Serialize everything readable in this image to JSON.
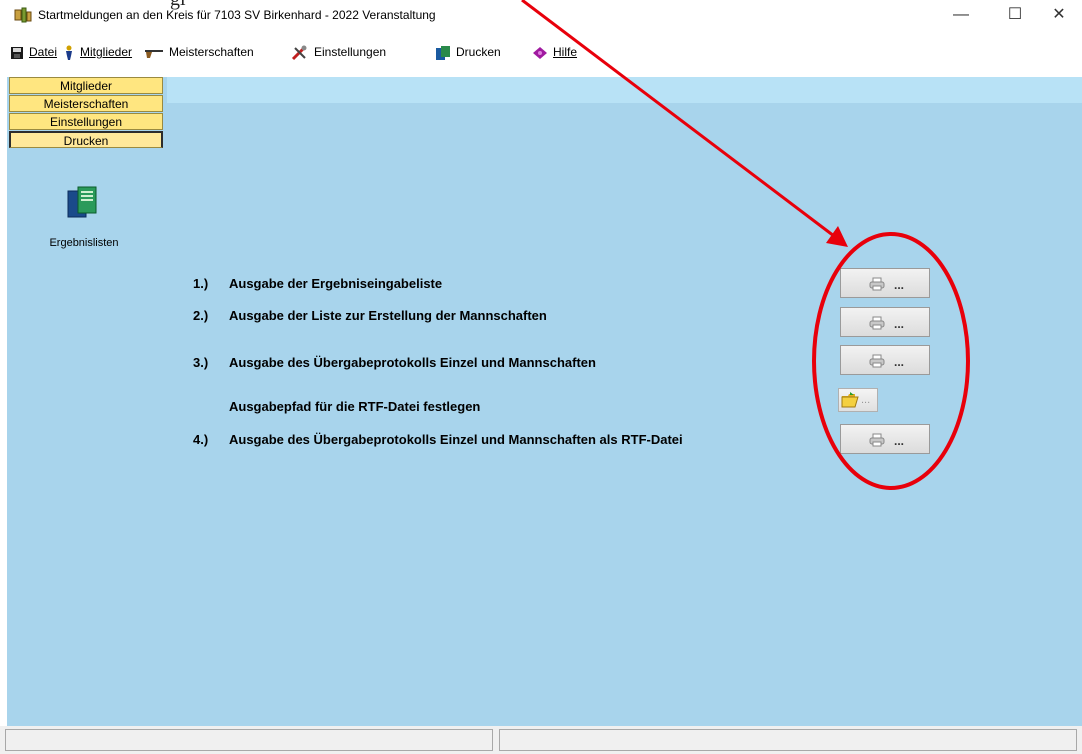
{
  "window": {
    "title": "Startmeldungen an den Kreis für 7103 SV Birkenhard - 2022  Veranstaltung",
    "controls": {
      "minimize": "—",
      "maximize": "☐",
      "close": "✕"
    }
  },
  "menu": [
    {
      "label": "Datei",
      "icon": "save-disk-icon"
    },
    {
      "label": "Mitglieder",
      "icon": "person-icon"
    },
    {
      "label": "Meisterschaften",
      "icon": "rifle-icon"
    },
    {
      "label": "Einstellungen",
      "icon": "tools-icon"
    },
    {
      "label": "Drucken",
      "icon": "printer-doc-icon"
    },
    {
      "label": "Hilfe",
      "icon": "help-book-icon"
    }
  ],
  "sidebar": {
    "nav": [
      {
        "label": "Mitglieder"
      },
      {
        "label": "Meisterschaften"
      },
      {
        "label": "Einstellungen"
      },
      {
        "label": "Drucken",
        "active": true
      }
    ],
    "tool": {
      "label": "Ergebnislisten",
      "icon": "result-lists-icon"
    }
  },
  "content": {
    "rows": [
      {
        "num": "1.)",
        "label": "Ausgabe der Ergebniseingabeliste",
        "button": "..."
      },
      {
        "num": "2.)",
        "label": "Ausgabe der Liste zur Erstellung der Mannschaften",
        "button": "..."
      },
      {
        "num": "3.)",
        "label": "Ausgabe des Übergabeprotokolls Einzel und Mannschaften",
        "button": "..."
      },
      {
        "num": "",
        "label": "Ausgabepfad für die RTF-Datei festlegen",
        "button": "..."
      },
      {
        "num": "4.)",
        "label": "Ausgabe des Übergabeprotokolls Einzel und Mannschaften als RTF-Datei",
        "button": "..."
      }
    ]
  },
  "annotation": {
    "top_fragment": "gi",
    "color": "#e8000b"
  },
  "colors": {
    "panel_bg": "#a8d4ec",
    "nav_button": "#ffe680"
  }
}
